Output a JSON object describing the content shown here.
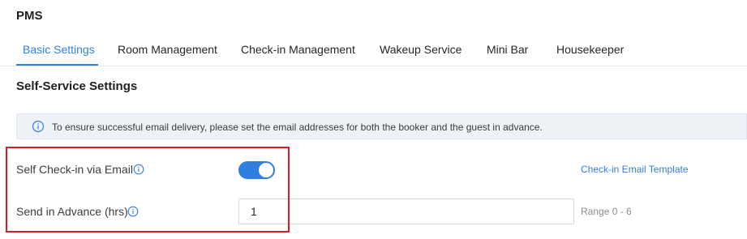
{
  "app": {
    "title": "PMS"
  },
  "tabs": [
    {
      "label": "Basic Settings",
      "active": true
    },
    {
      "label": "Room Management",
      "active": false
    },
    {
      "label": "Check-in Management",
      "active": false
    },
    {
      "label": "Wakeup Service",
      "active": false
    },
    {
      "label": "Mini Bar",
      "active": false
    },
    {
      "label": "Housekeeper",
      "active": false
    }
  ],
  "section": {
    "title": "Self-Service Settings"
  },
  "notice": {
    "icon": "info-icon",
    "text": "To ensure successful email delivery, please set the email addresses for both the booker and the guest in advance."
  },
  "self_checkin": {
    "label": "Self Check-in via Email",
    "enabled": true,
    "template_link": "Check-in Email Template"
  },
  "send_advance": {
    "label": "Send in Advance (hrs)",
    "value": "1",
    "range_hint": "Range 0 - 6"
  },
  "colors": {
    "accent": "#2f7fe0",
    "highlight": "#d32027",
    "notice_bg": "#eef2f7"
  }
}
